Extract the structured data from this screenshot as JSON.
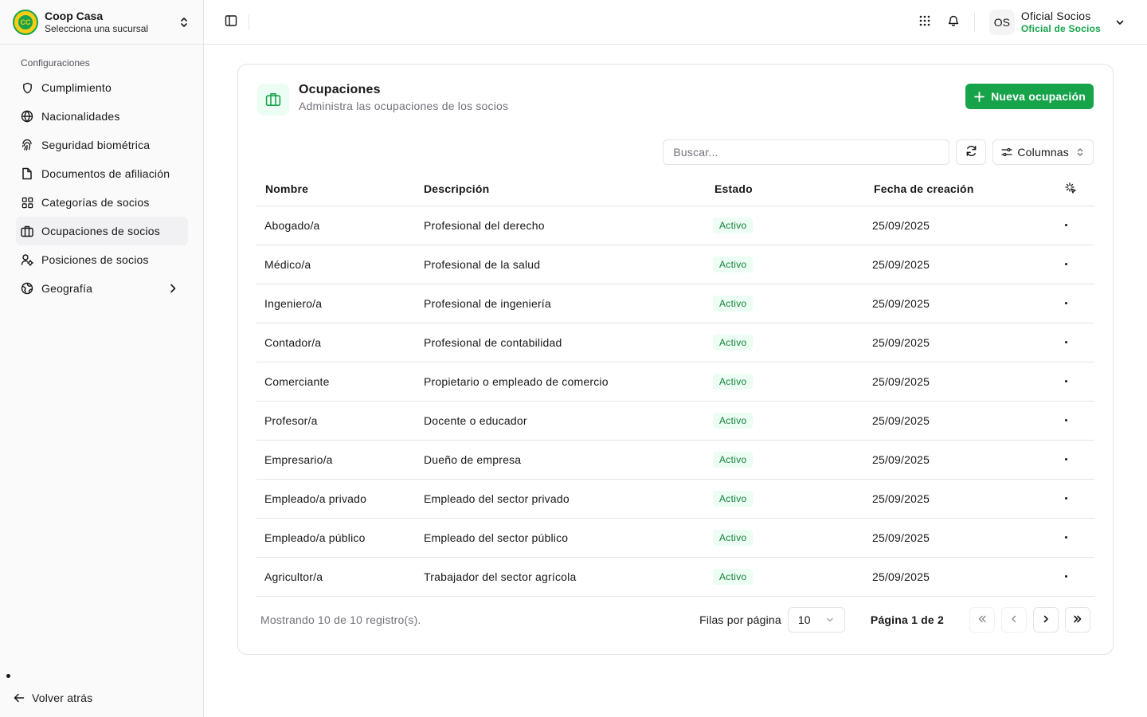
{
  "brand": {
    "title": "Coop Casa",
    "subtitle": "Selecciona una sucursal",
    "logo_text": "CC"
  },
  "sidebar": {
    "group_label": "Configuraciones",
    "items": [
      {
        "label": "Cumplimiento",
        "icon": "shield-icon"
      },
      {
        "label": "Nacionalidades",
        "icon": "globe-icon"
      },
      {
        "label": "Seguridad biométrica",
        "icon": "fingerprint-icon"
      },
      {
        "label": "Documentos de afiliación",
        "icon": "file-icon"
      },
      {
        "label": "Categorías de socios",
        "icon": "grid-icon"
      },
      {
        "label": "Ocupaciones de socios",
        "icon": "briefcase-icon",
        "active": true
      },
      {
        "label": "Posiciones de socios",
        "icon": "user-cog-icon"
      },
      {
        "label": "Geografía",
        "icon": "earth-icon",
        "has_children": true
      }
    ],
    "back_label": "Volver atrás"
  },
  "header": {
    "user": {
      "initials": "OS",
      "name": "Oficial Socios",
      "role": "Oficial de Socios"
    }
  },
  "page": {
    "title": "Ocupaciones",
    "subtitle": "Administra las ocupaciones de los socios",
    "new_button": "Nueva ocupación",
    "search_placeholder": "Buscar...",
    "columns_button": "Columnas"
  },
  "table": {
    "headers": {
      "name": "Nombre",
      "description": "Descripción",
      "status": "Estado",
      "created": "Fecha de creación"
    },
    "rows": [
      {
        "name": "Abogado/a",
        "description": "Profesional del derecho",
        "status": "Activo",
        "created": "25/09/2025"
      },
      {
        "name": "Médico/a",
        "description": "Profesional de la salud",
        "status": "Activo",
        "created": "25/09/2025"
      },
      {
        "name": "Ingeniero/a",
        "description": "Profesional de ingeniería",
        "status": "Activo",
        "created": "25/09/2025"
      },
      {
        "name": "Contador/a",
        "description": "Profesional de contabilidad",
        "status": "Activo",
        "created": "25/09/2025"
      },
      {
        "name": "Comerciante",
        "description": "Propietario o empleado de comercio",
        "status": "Activo",
        "created": "25/09/2025"
      },
      {
        "name": "Profesor/a",
        "description": "Docente o educador",
        "status": "Activo",
        "created": "25/09/2025"
      },
      {
        "name": "Empresario/a",
        "description": "Dueño de empresa",
        "status": "Activo",
        "created": "25/09/2025"
      },
      {
        "name": "Empleado/a privado",
        "description": "Empleado del sector privado",
        "status": "Activo",
        "created": "25/09/2025"
      },
      {
        "name": "Empleado/a público",
        "description": "Empleado del sector público",
        "status": "Activo",
        "created": "25/09/2025"
      },
      {
        "name": "Agricultor/a",
        "description": "Trabajador del sector agrícola",
        "status": "Activo",
        "created": "25/09/2025"
      }
    ]
  },
  "footer": {
    "count_text": "Mostrando 10 de 10 registro(s).",
    "rows_label": "Filas por página",
    "rows_value": "10",
    "page_label": "Página 1 de 2"
  },
  "colors": {
    "accent": "#16a34a",
    "badge_bg": "#ecfdf3",
    "badge_text": "#15803d",
    "border": "#e4e4e7"
  }
}
